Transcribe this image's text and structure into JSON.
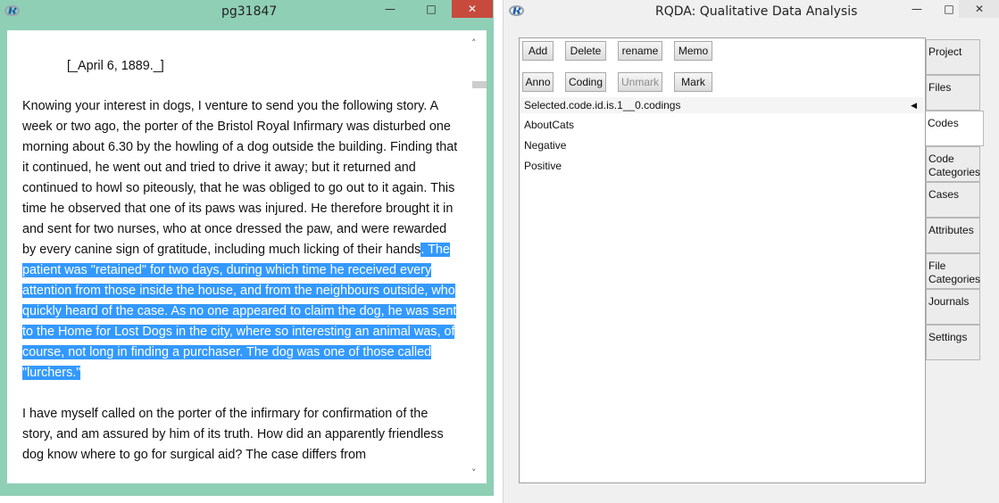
{
  "left_window": {
    "title": "pg31847",
    "icon": "r-logo-icon",
    "controls": {
      "minimize": "—",
      "maximize": "□",
      "close": "✕"
    },
    "scroll_up": "˄",
    "scroll_down": "˅",
    "document": {
      "dateline": "[_April 6, 1889._]",
      "para1_plain": "Knowing your interest in dogs, I venture to send you the following story. A week or two ago, the porter of the Bristol Royal Infirmary was disturbed one morning about 6.30 by the howling of a dog outside the building. Finding that it continued, he went out and tried to drive it away; but it returned and continued to howl so piteously, that he was obliged to go out to it again. This time he observed that one of its paws was injured. He therefore brought it in and sent for two nurses, who at once dressed the paw, and were rewarded by every canine sign of gratitude, including much licking of their hands",
      "para1_selected": ". The patient was \"retained\" for two days, during which time he received every attention from those inside the house, and from the neighbours outside, who quickly heard of the case. As no one appeared to claim the dog, he was sent to the Home for Lost Dogs in the city, where so interesting an animal was, of course, not long in finding a purchaser. The dog was one of those called \"lurchers.\"",
      "para2": "I have myself called on the porter of the infirmary for confirmation of the story, and am assured by him of its truth. How did an apparently friendless dog know where to go for surgical aid? The case differs from"
    }
  },
  "right_window": {
    "title": "RQDA: Qualitative Data Analysis",
    "icon": "r-logo-icon",
    "controls": {
      "minimize": "—",
      "maximize": "□",
      "close": "✕"
    },
    "buttons_row1": [
      "Add",
      "Delete",
      "rename",
      "Memo"
    ],
    "buttons_row2": [
      "Anno",
      "Coding",
      "Unmark",
      "Mark"
    ],
    "codings_header": "Selected.code.id.is.1__0.codings",
    "codings_header_arrow": "◀",
    "codes": [
      "AboutCats",
      "Negative",
      "Positive"
    ],
    "tabs": [
      "Project",
      "Files",
      "Codes",
      "Code Categories",
      "Cases",
      "Attributes",
      "File Categories",
      "Journals",
      "Settings"
    ],
    "active_tab": "Codes"
  }
}
